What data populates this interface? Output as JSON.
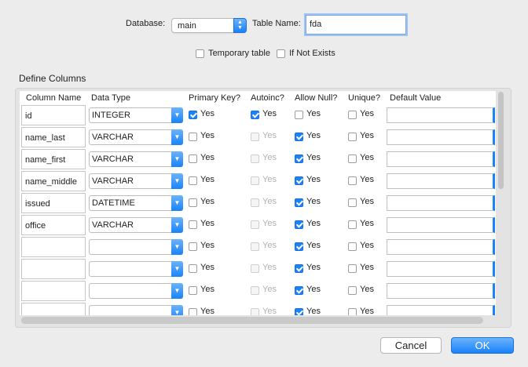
{
  "form": {
    "database_label": "Database:",
    "database_value": "main",
    "table_name_label": "Table Name:",
    "table_name_value": "fda",
    "temporary_label": "Temporary table",
    "if_not_exists_label": "If Not Exists"
  },
  "define_columns": {
    "title": "Define Columns",
    "headers": [
      "Column Name",
      "Data Type",
      "Primary Key?",
      "Autoinc?",
      "Allow Null?",
      "Unique?",
      "Default Value"
    ],
    "yes_label": "Yes",
    "rows": [
      {
        "name": "id",
        "type": "INTEGER",
        "pk": true,
        "autoinc": true,
        "autoinc_enabled": true,
        "allow_null": false,
        "unique": false
      },
      {
        "name": "name_last",
        "type": "VARCHAR",
        "pk": false,
        "autoinc": false,
        "autoinc_enabled": false,
        "allow_null": true,
        "unique": false
      },
      {
        "name": "name_first",
        "type": "VARCHAR",
        "pk": false,
        "autoinc": false,
        "autoinc_enabled": false,
        "allow_null": true,
        "unique": false
      },
      {
        "name": "name_middle",
        "type": "VARCHAR",
        "pk": false,
        "autoinc": false,
        "autoinc_enabled": false,
        "allow_null": true,
        "unique": false
      },
      {
        "name": "issued",
        "type": "DATETIME",
        "pk": false,
        "autoinc": false,
        "autoinc_enabled": false,
        "allow_null": true,
        "unique": false
      },
      {
        "name": "office",
        "type": "VARCHAR",
        "pk": false,
        "autoinc": false,
        "autoinc_enabled": false,
        "allow_null": true,
        "unique": false
      },
      {
        "name": "",
        "type": "",
        "pk": false,
        "autoinc": false,
        "autoinc_enabled": false,
        "allow_null": true,
        "unique": false
      },
      {
        "name": "",
        "type": "",
        "pk": false,
        "autoinc": false,
        "autoinc_enabled": false,
        "allow_null": true,
        "unique": false
      },
      {
        "name": "",
        "type": "",
        "pk": false,
        "autoinc": false,
        "autoinc_enabled": false,
        "allow_null": true,
        "unique": false
      },
      {
        "name": "",
        "type": "",
        "pk": false,
        "autoinc": false,
        "autoinc_enabled": false,
        "allow_null": true,
        "unique": false
      }
    ]
  },
  "buttons": {
    "cancel": "Cancel",
    "ok": "OK"
  },
  "colors": {
    "accent": "#1a82fb"
  }
}
